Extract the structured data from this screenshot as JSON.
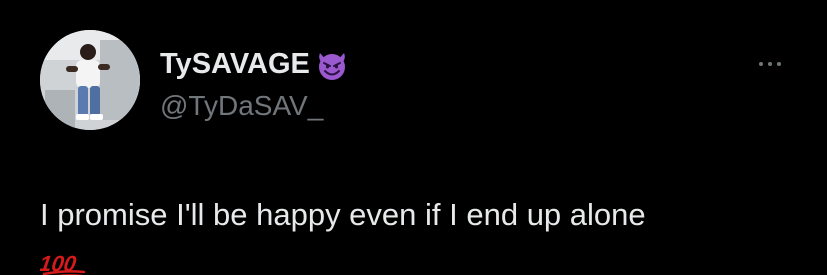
{
  "author": {
    "display_name": "TySAVAGE",
    "name_emoji": "smiling-devil-emoji",
    "handle": "@TyDaSAV_"
  },
  "tweet": {
    "text": "I promise I'll be happy even if I end up alone",
    "trailing_emoji": "hundred-points-emoji"
  },
  "colors": {
    "background": "#000000",
    "primary_text": "#e7e9ea",
    "secondary_text": "#71767b",
    "emoji_purple": "#9b59d0",
    "emoji_red": "#d41a1a"
  },
  "icons": {
    "more": "more-options-icon"
  }
}
